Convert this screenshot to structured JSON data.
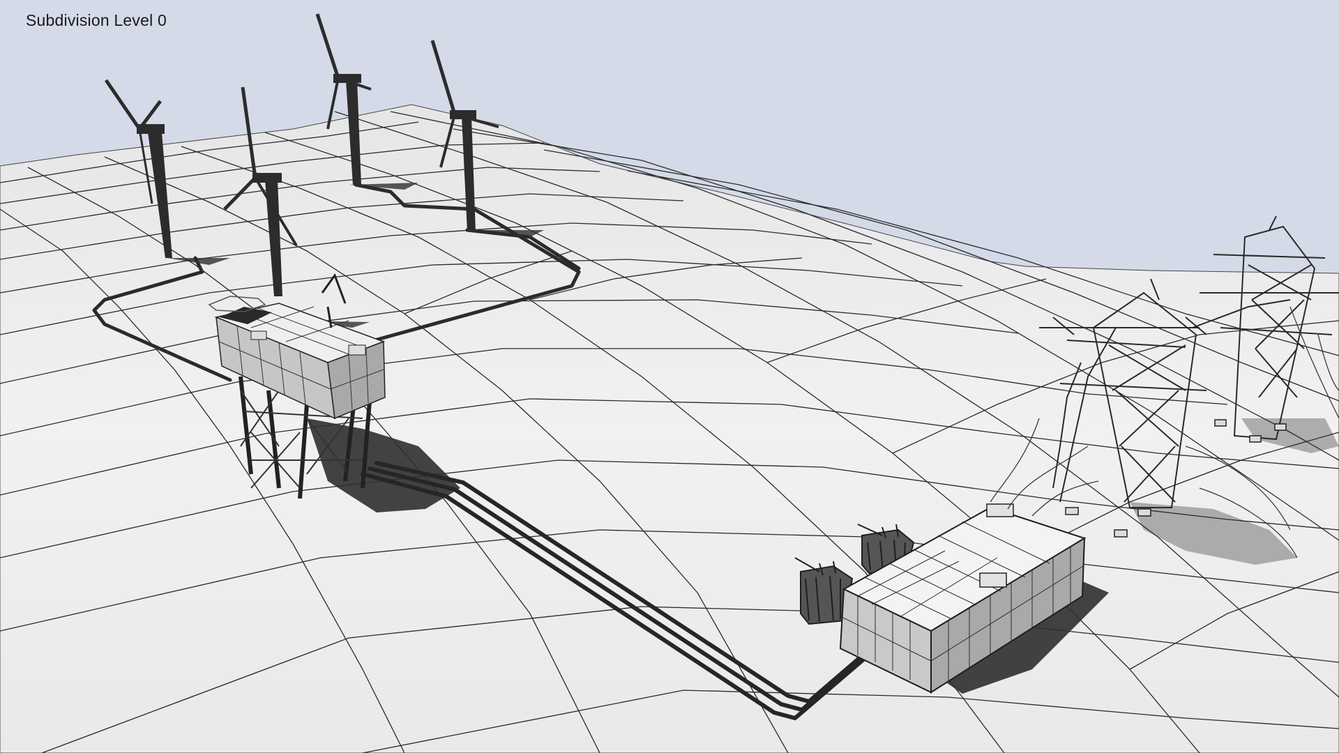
{
  "viewport": {
    "overlay_label": "Subdivision Level 0"
  },
  "colors": {
    "sky": "#d5dae8",
    "ground": "#ececec",
    "grid": "#2a2a2a",
    "model": "#2b2b2b",
    "shadow": "#2e2e2e"
  },
  "scene": {
    "objects": [
      "wind-turbine",
      "wind-turbine",
      "wind-turbine",
      "wind-turbine",
      "offshore-substation-platform",
      "onshore-substation-building",
      "transformer",
      "transformer",
      "transmission-tower",
      "transmission-tower",
      "cable-bundle"
    ]
  }
}
